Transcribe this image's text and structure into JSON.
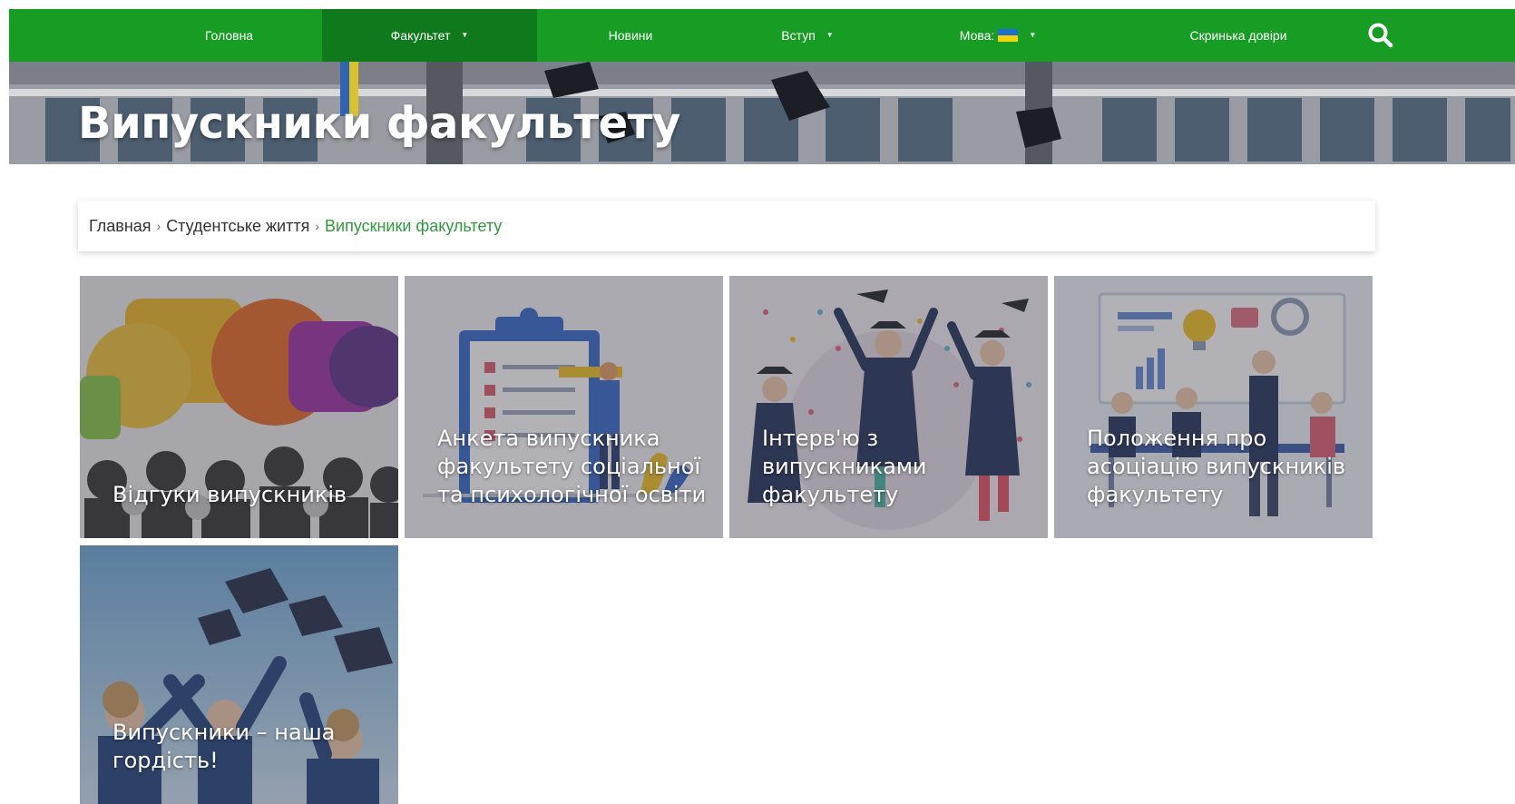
{
  "nav": {
    "items": [
      {
        "label": "Головна",
        "dropdown": false
      },
      {
        "label": "Факультет",
        "dropdown": true,
        "active": true
      },
      {
        "label": "Новини",
        "dropdown": false
      },
      {
        "label": "Вступ",
        "dropdown": true
      },
      {
        "label": "Мова:",
        "dropdown": true
      },
      {
        "label": "Скринька довіри",
        "dropdown": false
      }
    ],
    "caret": "▼",
    "color": "#179c24",
    "active_color": "#0f7a1b"
  },
  "hero": {
    "title": "Випускники факультету"
  },
  "breadcrumb": {
    "items": [
      "Главная",
      "Студентське життя"
    ],
    "current": "Випускники факультету",
    "separator": "›"
  },
  "cards": [
    {
      "title": "Відгуки випускників",
      "icon": "speech-bubbles-people"
    },
    {
      "title": "Анкета випускника факультету соціальної та психологічної освіти",
      "icon": "clipboard-checklist"
    },
    {
      "title": "Інтерв'ю з випускниками факультету",
      "icon": "graduates-celebrating"
    },
    {
      "title": "Положення про асоціацію випускників факультету",
      "icon": "team-meeting"
    },
    {
      "title": "Випускники – наша гордість!",
      "icon": "graduation-caps-thrown"
    }
  ]
}
